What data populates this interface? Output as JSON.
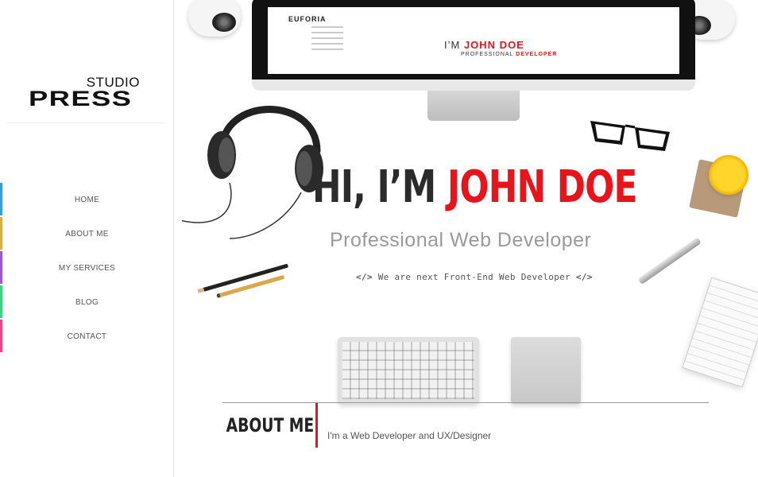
{
  "sidebar": {
    "logo": {
      "top": "STUDIO",
      "bottom": "PRESS"
    },
    "nav": [
      {
        "label": "HOME",
        "color": "#3a9bd5"
      },
      {
        "label": "ABOUT ME",
        "color": "#d8b04a"
      },
      {
        "label": "MY SERVICES",
        "color": "#9b59d0"
      },
      {
        "label": "BLOG",
        "color": "#3fd08a"
      },
      {
        "label": "CONTACT",
        "color": "#e64a8a"
      }
    ]
  },
  "hero": {
    "title_prefix": "HI, I’M ",
    "title_name": "JOHN DOE",
    "subtitle": "Professional Web Developer",
    "tagline_open": "</>",
    "tagline_text": " We are next Front-End Web Developer ",
    "tagline_close": "</>",
    "screen": {
      "logo": "EUFORIA",
      "heading_prefix": "I’M ",
      "heading_name": "JOHN DOE",
      "sub_prefix": "PROFESSIONAL ",
      "sub_bold": "DEVELOPER"
    }
  },
  "about": {
    "heading": "ABOUT ME",
    "text": "I'm a Web Developer and UX/Designer"
  },
  "colors": {
    "accent": "#e8141b",
    "title": "#2b2b2b",
    "subtitle": "#9a9a9a"
  }
}
